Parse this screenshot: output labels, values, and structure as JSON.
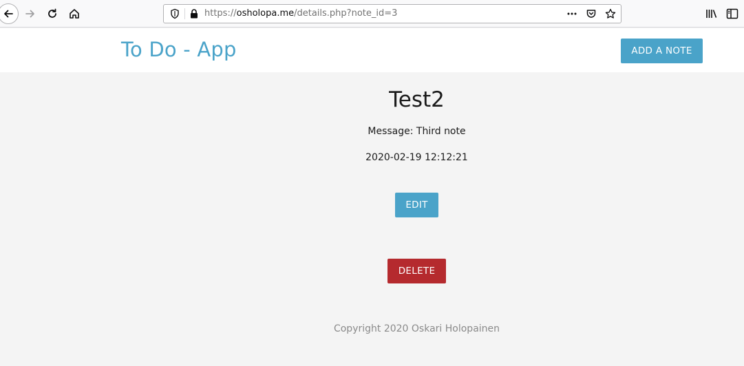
{
  "browser": {
    "url_scheme": "https://",
    "url_host": "osholopa.me",
    "url_path": "/details.php?note_id=3"
  },
  "header": {
    "brand": "To Do - App",
    "add_note_label": "ADD A NOTE"
  },
  "note": {
    "title": "Test2",
    "message_line": "Message: Third note",
    "timestamp": "2020-02-19 12:12:21"
  },
  "actions": {
    "edit_label": "EDIT",
    "delete_label": "DELETE"
  },
  "footer": {
    "copyright": "Copyright 2020 Oskari Holopainen"
  },
  "colors": {
    "accent": "#4aa3c9",
    "danger": "#b52a2e",
    "page_bg": "#f4f4f4"
  }
}
